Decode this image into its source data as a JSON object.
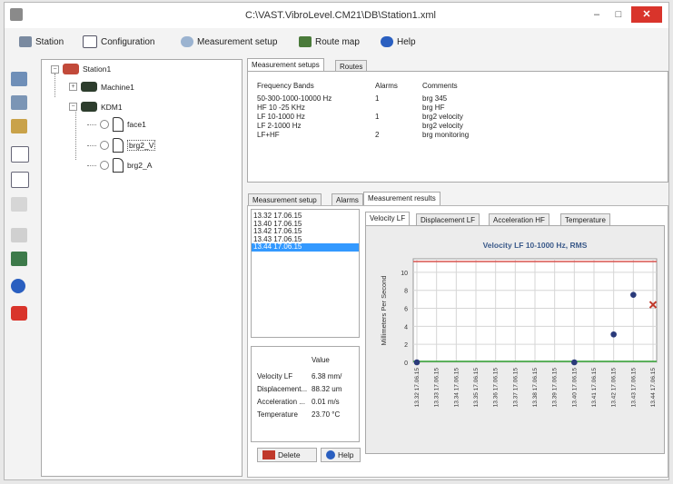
{
  "window": {
    "title": "C:\\VAST.VibroLevel.CM21\\DB\\Station1.xml",
    "minimize_glyph": "–",
    "maximize_glyph": "□",
    "close_glyph": "✕"
  },
  "menu": [
    {
      "label": "Station",
      "icon": "station-icon"
    },
    {
      "label": "Configuration",
      "icon": "configuration-icon"
    },
    {
      "label": "Measurement setup",
      "icon": "gear-icon"
    },
    {
      "label": "Route map",
      "icon": "route-map-icon"
    },
    {
      "label": "Help",
      "icon": "help-icon"
    }
  ],
  "tree": {
    "root": "Station1",
    "machines": [
      {
        "label": "Machine1",
        "expander": "+"
      },
      {
        "label": "KDM1",
        "expander": "−"
      }
    ],
    "sensors": [
      "face1",
      "brg2_V",
      "brg2_A"
    ]
  },
  "setups": {
    "tabs": [
      "Measurement setups",
      "Routes"
    ],
    "headers": [
      "Frequency Bands",
      "Alarms",
      "Comments"
    ],
    "rows": [
      {
        "band": "50-300-1000-10000 Hz",
        "alarms": "1",
        "comment": "brg 345"
      },
      {
        "band": "HF 10 -25 KHz",
        "alarms": "",
        "comment": "brg HF"
      },
      {
        "band": "LF 10-1000 Hz",
        "alarms": "1",
        "comment": "brg2 velocity"
      },
      {
        "band": "LF 2-1000 Hz",
        "alarms": "",
        "comment": "brg2 velocity"
      },
      {
        "band": "LF+HF",
        "alarms": "2",
        "comment": "brg monitoring"
      }
    ]
  },
  "lower_tabs": [
    "Measurement setup",
    "Alarms",
    "Measurement results"
  ],
  "timestamps": [
    "13.32 17.06.15",
    "13.40 17.06.15",
    "13.42 17.06.15",
    "13.43 17.06.15",
    "13.44 17.06.15"
  ],
  "values_table": {
    "header": "Value",
    "rows": [
      {
        "name": "Velocity LF",
        "value": "6.38 mm/"
      },
      {
        "name": "Displacement...",
        "value": "88.32 um"
      },
      {
        "name": "Acceleration ...",
        "value": "0.01 m/s"
      },
      {
        "name": "Temperature",
        "value": "23.70 °C"
      }
    ]
  },
  "buttons": {
    "delete": "Delete",
    "help": "Help"
  },
  "result_tabs": [
    "Velocity LF",
    "Displacement LF",
    "Acceleration HF",
    "Temperature"
  ],
  "chart_data": {
    "type": "scatter",
    "title": "Velocity LF 10-1000 Hz, RMS",
    "ylabel": "Millimeters Per Second",
    "xlabel": "",
    "categories": [
      "13.32 17.06.15",
      "13.33 17.06.15",
      "13.34 17.06.15",
      "13.35 17.06.15",
      "13.36 17.06.15",
      "13.37 17.06.15",
      "13.38 17.06.15",
      "13.39 17.06.15",
      "13.40 17.06.15",
      "13.41 17.06.15",
      "13.42 17.06.15",
      "13.43 17.06.15",
      "13.44 17.06.15"
    ],
    "yticks": [
      "0",
      "2",
      "4",
      "6",
      "8",
      "10"
    ],
    "ylim": [
      0,
      11.5
    ],
    "points": [
      {
        "x": "13.32 17.06.15",
        "y": 0.0,
        "marker": "dot"
      },
      {
        "x": "13.40 17.06.15",
        "y": 0.0,
        "marker": "dot"
      },
      {
        "x": "13.42 17.06.15",
        "y": 3.1,
        "marker": "dot"
      },
      {
        "x": "13.43 17.06.15",
        "y": 7.5,
        "marker": "dot"
      },
      {
        "x": "13.44 17.06.15",
        "y": 6.4,
        "marker": "cross"
      }
    ],
    "thresholds": [
      {
        "y": 11.2,
        "color": "#d9534f"
      },
      {
        "y": 0.1,
        "color": "#2e9e2e"
      }
    ],
    "grid": true,
    "colors": {
      "point": "#2a3a7a",
      "cross": "#c0392b",
      "title": "#3b5a8a",
      "plot_bg": "#ffffff",
      "outer_bg": "#ececec"
    }
  }
}
